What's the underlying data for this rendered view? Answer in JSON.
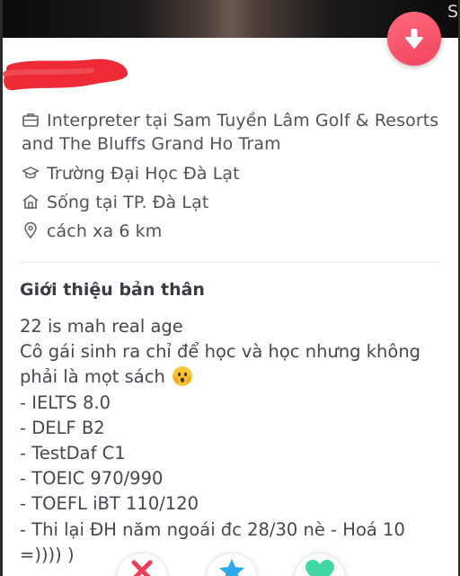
{
  "header": {
    "corner_letter": "S",
    "fab_icon": "arrow-down-icon",
    "fab_color": "#f5475f"
  },
  "profile": {
    "name_redaction_color": "#ee2a36",
    "job_icon": "briefcase-icon",
    "job_line1": "Interpreter tại Sam Tuyền Lâm Golf & Resorts",
    "job_line2": "and The Bluffs Grand Ho Tram",
    "school_icon": "graduation-cap-icon",
    "school": "Trường Đại Học Đà Lạt",
    "city_icon": "home-icon",
    "city": "Sống tại TP. Đà Lạt",
    "distance_icon": "location-pin-icon",
    "distance": "cách xa 6 km"
  },
  "about": {
    "title": "Giới thiệu bản thân",
    "lines": [
      "22 is mah real age",
      "Cô gái sinh ra chỉ để học và học nhưng không",
      "phải là mọt sách",
      "- IELTS 8.0",
      "- DELF B2",
      "- TestDaf C1",
      "- TOEIC 970/990",
      "- TOEFL iBT 110/120",
      "- Thi lại ĐH năm ngoái đc 28/30 nè - Hoá 10",
      "=)))) )"
    ],
    "emoji_icon": "hands-over-face-emoji"
  },
  "actions": {
    "nope_icon": "x-icon",
    "nope_color": "#f23a5a",
    "superlike_icon": "star-icon",
    "superlike_color": "#2da8ea",
    "like_icon": "heart-icon",
    "like_color": "#3fd8a6"
  }
}
